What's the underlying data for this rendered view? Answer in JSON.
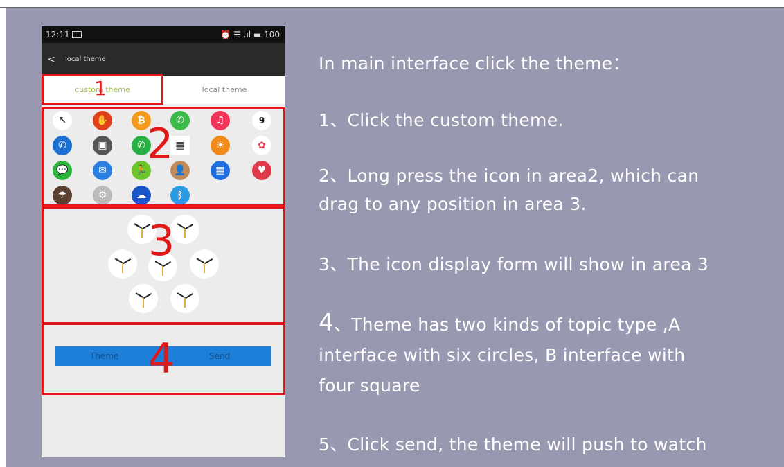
{
  "phone": {
    "status": {
      "time": "12:11",
      "right": "⏰ ☰ .ıl ▬ 100"
    },
    "appbar": {
      "back": "<",
      "title": "local theme"
    },
    "tabs": [
      "custom theme",
      "local theme"
    ],
    "calendar_day": "9",
    "buttons": {
      "theme": "Theme",
      "send": "Send"
    }
  },
  "annotations": [
    "1",
    "2",
    "3",
    "4"
  ],
  "instructions": {
    "heading": "In main interface click the theme：",
    "step1": "1、Click the custom theme.",
    "step2_line1": "2、Long press the icon in area2, which can",
    "step2_line2": "drag to any position in area 3.",
    "step3": "3、The icon display form will show in area 3",
    "step4_num": "4",
    "step4_line1": "、Theme has two kinds of topic type ,A",
    "step4_line2": "interface with six  circles, B interface with",
    "step4_line3": "four  square",
    "step5": "5、Click send, the theme will push to watch"
  },
  "colors": {
    "background": "#9898b0",
    "annotation": "#e01818",
    "button": "#1e7fd8",
    "tab_active": "#9cbe4a"
  }
}
